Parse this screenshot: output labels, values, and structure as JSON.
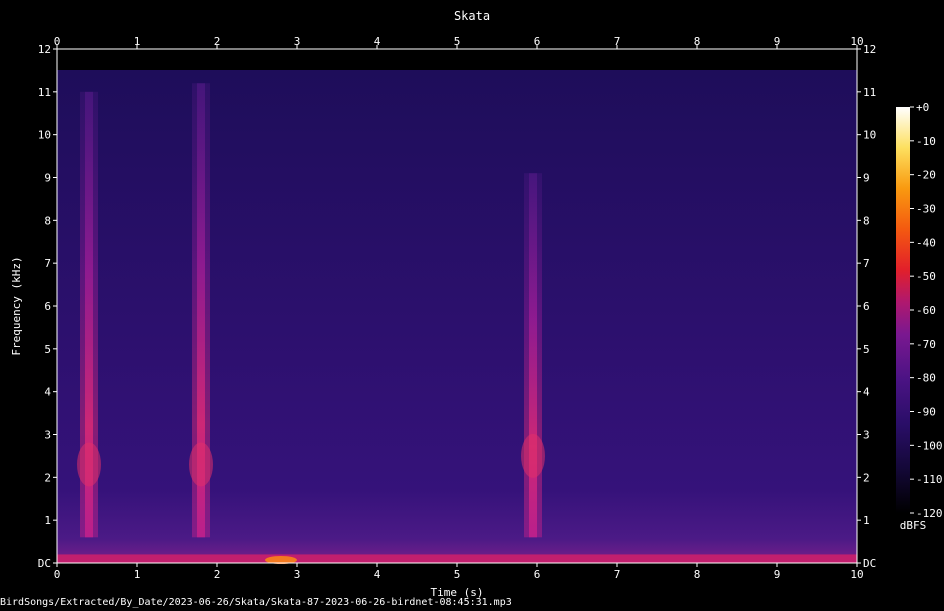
{
  "chart_data": {
    "type": "heatmap",
    "subtype": "spectrogram",
    "title": "Skata",
    "xlabel": "Time (s)",
    "ylabel": "Frequency (kHz)",
    "xlim": [
      0,
      10
    ],
    "ylim": [
      0,
      12
    ],
    "x_ticks": [
      "0",
      "1",
      "2",
      "3",
      "4",
      "5",
      "6",
      "7",
      "8",
      "9",
      "10"
    ],
    "y_ticks": [
      "DC",
      "1",
      "2",
      "3",
      "4",
      "5",
      "6",
      "7",
      "8",
      "9",
      "10",
      "11",
      "12"
    ],
    "colorbar": {
      "label": "dBFS",
      "range": [
        -120,
        0
      ],
      "ticks": [
        "+0",
        "-10",
        "-20",
        "-30",
        "-40",
        "-50",
        "-60",
        "-70",
        "-80",
        "-90",
        "-100",
        "-110",
        "-120"
      ],
      "colors": [
        "#000000",
        "#1a0a40",
        "#3b0f70",
        "#6a1b8a",
        "#a0206e",
        "#d63a3a",
        "#f4741f",
        "#fbb040",
        "#fde68a",
        "#ffffff"
      ]
    },
    "background_level_dbfs": -100,
    "calls": [
      {
        "time_s": 0.4,
        "freq_min_khz": 0.6,
        "freq_max_khz": 11.0,
        "peak_freq_khz": 2.3,
        "peak_dbfs": -60
      },
      {
        "time_s": 1.8,
        "freq_min_khz": 0.6,
        "freq_max_khz": 11.2,
        "peak_freq_khz": 2.3,
        "peak_dbfs": -60
      },
      {
        "time_s": 5.95,
        "freq_min_khz": 0.6,
        "freq_max_khz": 9.1,
        "peak_freq_khz": 2.5,
        "peak_dbfs": -62
      }
    ],
    "low_frequency_band": {
      "freq_max_khz": 0.2,
      "peak_time_s": 2.8,
      "peak_dbfs": -50
    }
  },
  "caption": "BirdSongs/Extracted/By_Date/2023-06-26/Skata/Skata-87-2023-06-26-birdnet-08:45:31.mp3"
}
